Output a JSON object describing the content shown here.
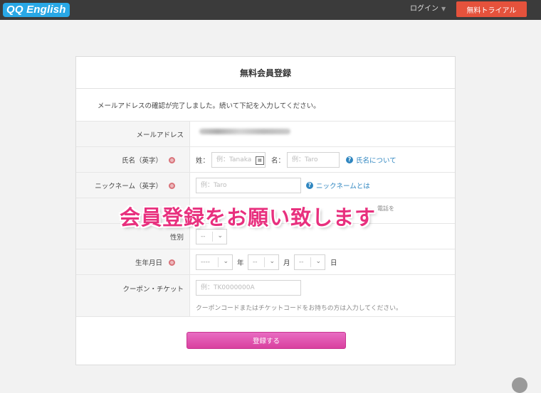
{
  "header": {
    "logo": "QQ English",
    "login": "ログイン",
    "trial_button": "無料トライアル"
  },
  "form": {
    "title": "無料会員登録",
    "notice": "メールアドレスの確認が完了しました。続いて下記を入力してください。",
    "email": {
      "label": "メールアドレス"
    },
    "name": {
      "label": "氏名（英字）",
      "last_label": "姓：",
      "last_placeholder": "例：Tanaka",
      "first_label": "名：",
      "first_placeholder": "例：Taro",
      "help": "氏名について"
    },
    "nickname": {
      "label": "ニックネーム（英字）",
      "placeholder": "例：Taro",
      "help": "ニックネームとは"
    },
    "partial_text": "電話を",
    "gender": {
      "label": "性別",
      "value": "--"
    },
    "birthdate": {
      "label": "生年月日",
      "year_value": "----",
      "year_unit": "年",
      "month_value": "--",
      "month_unit": "月",
      "day_value": "--",
      "day_unit": "日"
    },
    "coupon": {
      "label": "クーポン・チケット",
      "placeholder": "例：TK0000000A",
      "note": "クーポンコードまたはチケットコードをお持ちの方は入力してください。"
    },
    "submit": "登録する"
  },
  "overlay": "会員登録をお願い致します",
  "colors": {
    "accent_pink": "#d9409f",
    "trial_red": "#e5523c",
    "link_blue": "#2f86c0",
    "overlay_pink": "#e8307e"
  }
}
